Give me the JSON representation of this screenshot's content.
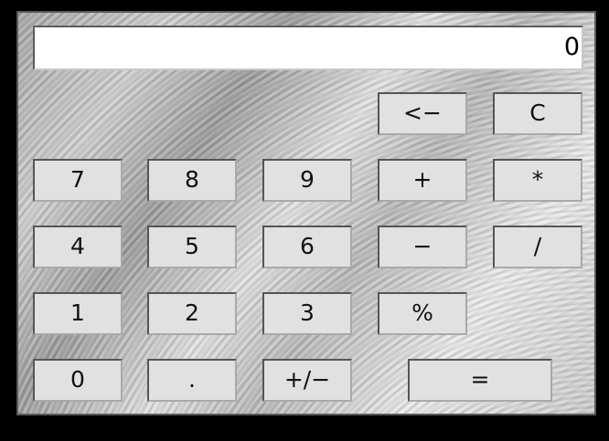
{
  "display": {
    "value": "0"
  },
  "keys": {
    "backspace": "<−",
    "clear": "C",
    "seven": "7",
    "eight": "8",
    "nine": "9",
    "plus": "+",
    "multiply": "*",
    "four": "4",
    "five": "5",
    "six": "6",
    "minus": "−",
    "divide": "/",
    "one": "1",
    "two": "2",
    "three": "3",
    "percent": "%",
    "zero": "0",
    "decimal": ".",
    "negate": "+/−",
    "equals": "="
  }
}
